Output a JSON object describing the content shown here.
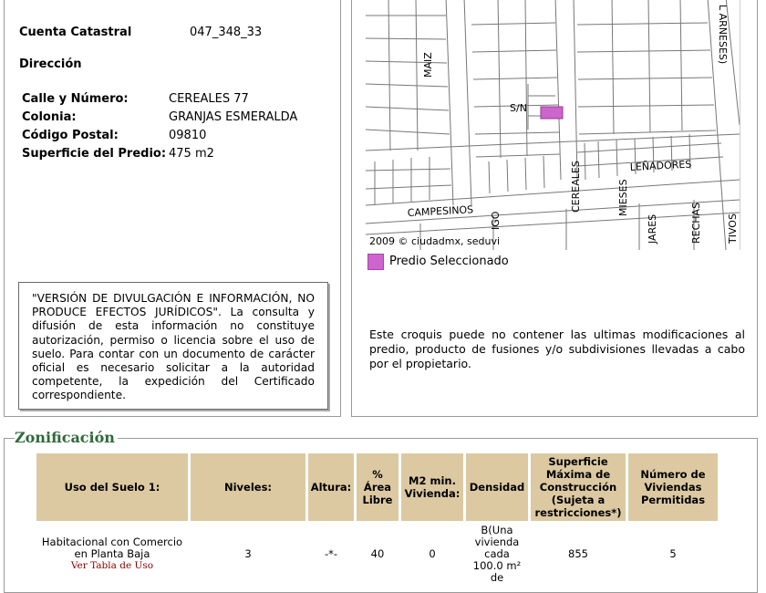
{
  "cuenta": {
    "label": "Cuenta Catastral",
    "value": "047_348_33"
  },
  "direccion": {
    "heading": "Dirección",
    "fields": [
      {
        "label": "Calle y Número:",
        "value": "CEREALES 77"
      },
      {
        "label": "Colonia:",
        "value": "GRANJAS ESMERALDA"
      },
      {
        "label": "Código Postal:",
        "value": "09810"
      },
      {
        "label": "Superficie del Predio:",
        "value": "475 m2"
      }
    ]
  },
  "disclaimer": "\"VERSIÓN DE DIVULGACIÓN E INFORMACIÓN, NO PRODUCE EFECTOS JURÍDICOS\". La consulta y difusión de esta información no constituye autorización, permiso o licencia sobre el uso de suelo. Para contar con un documento de carácter oficial es necesario solicitar a la autoridad competente, la expedición del Certificado correspondiente.",
  "map": {
    "street_labels": [
      "MAIZ",
      "S/N",
      "CEREALES",
      "MIESES",
      "LEÑADORES",
      "CAMPESINOS",
      "IGO",
      "JARES",
      "RECHAS",
      "TIVOS",
      "L ARNESES)"
    ],
    "copyright": "2009 © ciudadmx, seduvi",
    "selected_color": "#cc66cc",
    "legend_label": "Predio Seleccionado",
    "note": "Este croquis puede no contener las ultimas modificaciones al predio, producto de fusiones y/o subdivisiones llevadas a cabo por el propietario."
  },
  "zonificacion": {
    "title": "Zonificación",
    "headers": [
      "Uso del Suelo 1:",
      "Niveles:",
      "Altura:",
      "% Área Libre",
      "M2 min. Vivienda:",
      "Densidad",
      "Superficie Máxima de Construcción (Sujeta a restricciones*)",
      "Número de Viviendas Permitidas"
    ],
    "row": {
      "uso": "Habitacional con Comercio en Planta Baja",
      "uso_link": "Ver Tabla de Uso",
      "niveles": "3",
      "altura": "-*-",
      "area_libre": "40",
      "m2_min": "0",
      "densidad": "B(Una vivienda cada 100.0 m² de",
      "superficie_max": "855",
      "viviendas": "5"
    }
  }
}
